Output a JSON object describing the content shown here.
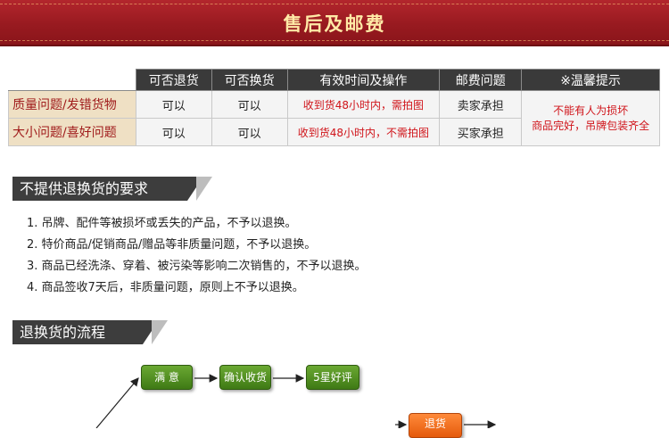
{
  "banner": {
    "title": "售后及邮费"
  },
  "policy_table": {
    "headers": [
      "可否退货",
      "可否换货",
      "有效时间及操作",
      "邮费问题",
      "※温馨提示"
    ],
    "rows": [
      {
        "label": "质量问题/发错货物",
        "return": "可以",
        "exchange": "可以",
        "time": "收到货48小时内，需拍图",
        "postage": "卖家承担"
      },
      {
        "label": "大小问题/喜好问题",
        "return": "可以",
        "exchange": "可以",
        "time": "收到货48小时内，不需拍图",
        "postage": "买家承担"
      }
    ],
    "tip_line1": "不能有人为损坏",
    "tip_line2": "商品完好，吊牌包装齐全"
  },
  "no_return_section": {
    "title": "不提供退换货的要求",
    "items": [
      "1. 吊牌、配件等被损坏或丢失的产品，不予以退换。",
      "2. 特价商品/促销商品/赠品等非质量问题，不予以退换。",
      "3. 商品已经洗涤、穿着、被污染等影响二次销售的，不予以退换。",
      "4. 商品签收7天后，非质量问题，原则上不予以退换。"
    ]
  },
  "process_section": {
    "title": "退换货的流程",
    "steps": {
      "satisfied": "满  意",
      "confirm": "确认收货",
      "review": "5星好评",
      "return": "退货"
    }
  },
  "colors": {
    "banner_red": "#981a20",
    "title_gold": "#ffe9a6",
    "alert_red": "#d0141a",
    "step_green": "#4f8a1f",
    "step_orange": "#f26b1d"
  }
}
